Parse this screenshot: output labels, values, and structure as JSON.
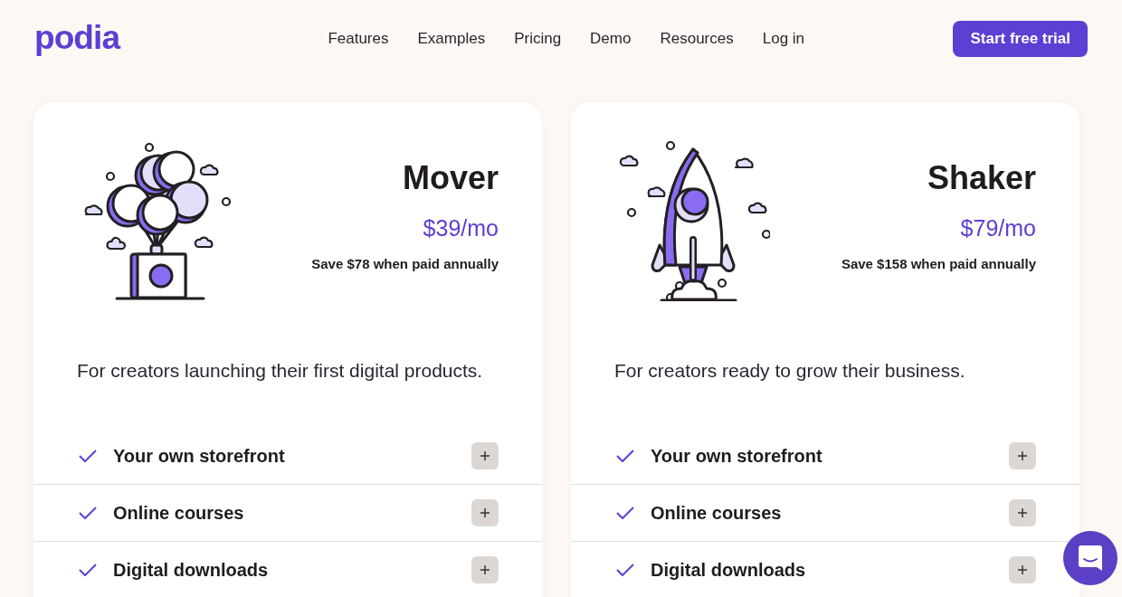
{
  "nav": {
    "logo": "podia",
    "links": [
      "Features",
      "Examples",
      "Pricing",
      "Demo",
      "Resources",
      "Log in"
    ],
    "cta": "Start free trial"
  },
  "plans": [
    {
      "kind": "balloons",
      "name": "Mover",
      "price": "$39/mo",
      "savings": "Save $78 when paid annually",
      "description": "For creators launching their first digital products.",
      "features": [
        "Your own storefront",
        "Online courses",
        "Digital downloads"
      ]
    },
    {
      "kind": "rocket",
      "name": "Shaker",
      "price": "$79/mo",
      "savings": "Save $158 when paid annually",
      "description": "For creators ready to grow their business.",
      "features": [
        "Your own storefront",
        "Online courses",
        "Digital downloads"
      ]
    }
  ]
}
